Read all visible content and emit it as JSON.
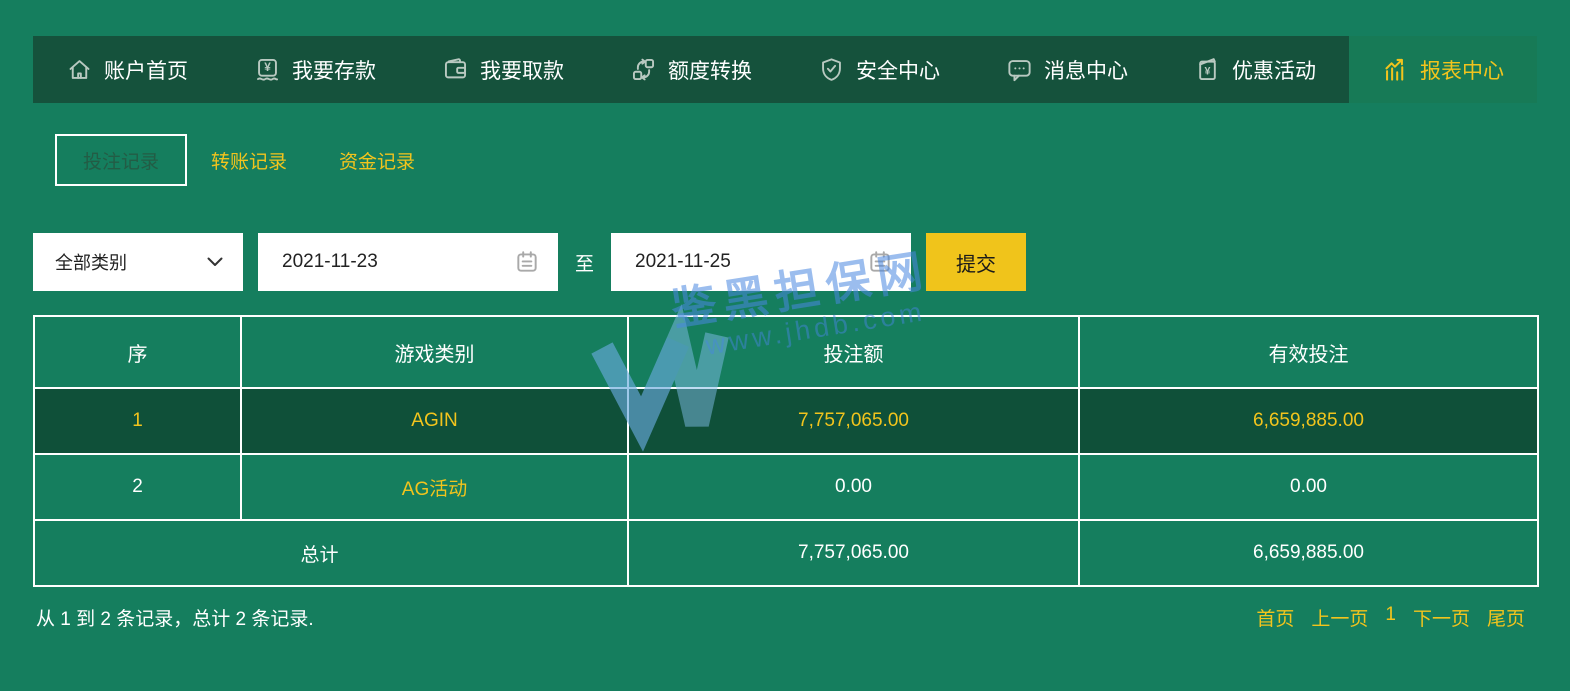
{
  "nav": {
    "items": [
      {
        "label": "账户首页",
        "icon": "home-icon"
      },
      {
        "label": "我要存款",
        "icon": "deposit-icon"
      },
      {
        "label": "我要取款",
        "icon": "wallet-icon"
      },
      {
        "label": "额度转换",
        "icon": "transfer-icon"
      },
      {
        "label": "安全中心",
        "icon": "shield-check-icon"
      },
      {
        "label": "消息中心",
        "icon": "message-icon"
      },
      {
        "label": "优惠活动",
        "icon": "red-packet-icon"
      },
      {
        "label": "报表中心",
        "icon": "bar-chart-icon",
        "active": true
      }
    ]
  },
  "tabs": {
    "items": [
      {
        "label": "投注记录",
        "active": true
      },
      {
        "label": "转账记录",
        "active": false
      },
      {
        "label": "资金记录",
        "active": false
      }
    ]
  },
  "filters": {
    "category": {
      "value": "全部类别"
    },
    "date_from": "2021-11-23",
    "to_label": "至",
    "date_to": "2021-11-25",
    "submit_label": "提交"
  },
  "table": {
    "columns": [
      "序",
      "游戏类别",
      "投注额",
      "有效投注"
    ],
    "rows": [
      {
        "no": "1",
        "game": "AGIN",
        "bet": "7,757,065.00",
        "valid": "6,659,885.00",
        "highlighted": true
      },
      {
        "no": "2",
        "game": "AG活动",
        "bet": "0.00",
        "valid": "0.00",
        "highlighted": false
      }
    ],
    "total": {
      "label": "总计",
      "bet": "7,757,065.00",
      "valid": "6,659,885.00"
    }
  },
  "footer": {
    "summary": "从 1 到 2 条记录，总计 2 条记录."
  },
  "pagination": {
    "first": "首页",
    "prev": "上一页",
    "current": "1",
    "next": "下一页",
    "last": "尾页"
  },
  "watermark": {
    "title": "鉴黑担保网",
    "url": "www.jhdb.com"
  },
  "colors": {
    "page_green": "#157E5E",
    "nav_green": "#15523C",
    "row_highlight_green": "#0F5039",
    "accent_yellow": "#F2C41D",
    "watermark_blue": "#4886E0",
    "white": "#FFFFFF"
  }
}
